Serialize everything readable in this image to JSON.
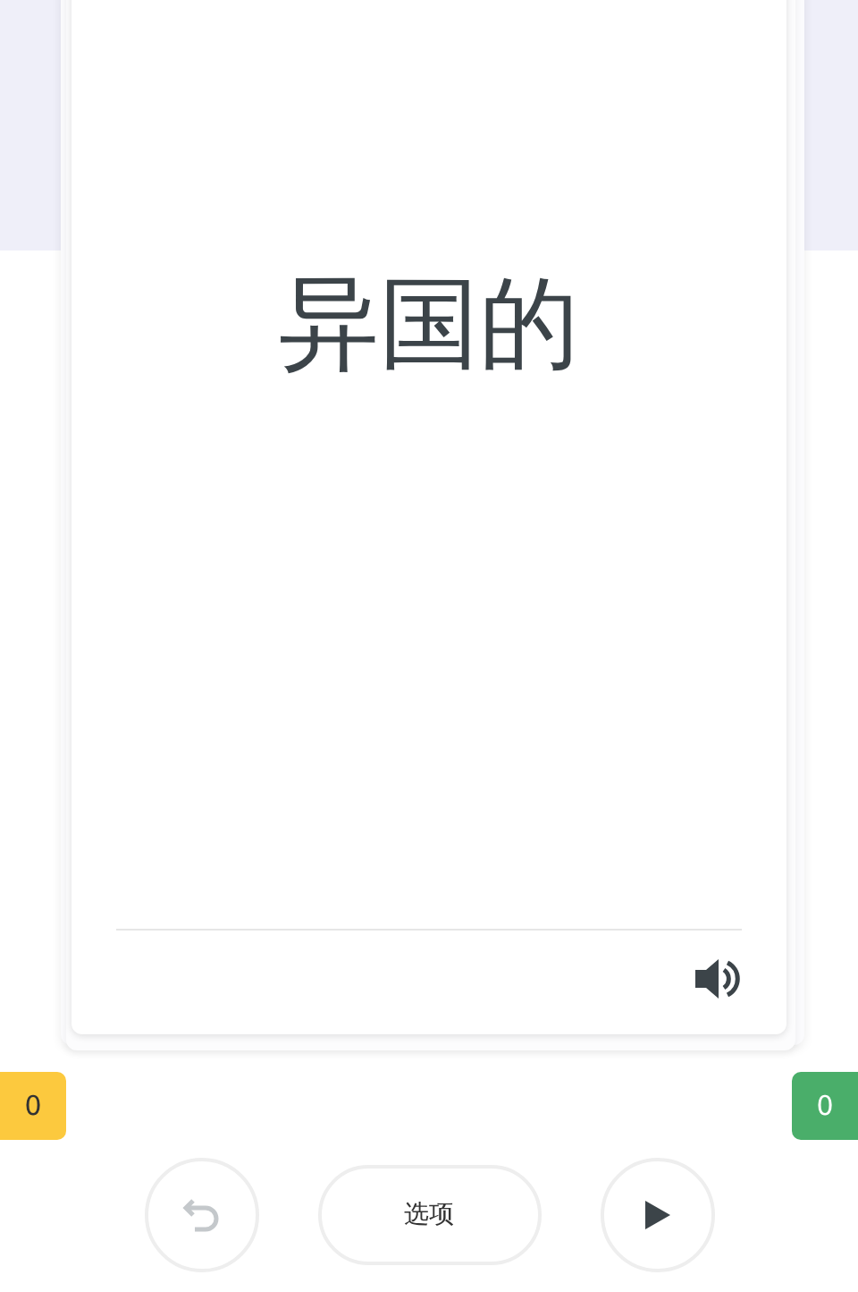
{
  "card": {
    "word": "异国的"
  },
  "counters": [
    {
      "value": "0",
      "color": "#fcc93e"
    },
    {
      "value": "0",
      "color": "#4aae6a"
    }
  ],
  "controls": {
    "undo": {
      "disabled": true
    },
    "options": {
      "label": "选项"
    },
    "play": {
      "disabled": false
    }
  }
}
